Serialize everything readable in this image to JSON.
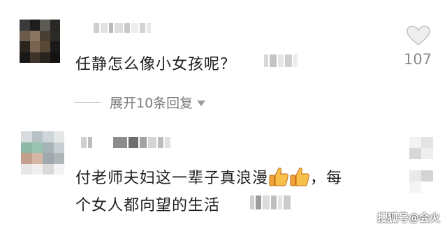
{
  "comments": [
    {
      "text": "任静怎么像小女孩呢？",
      "like_count": "107",
      "expand_label": "展开10条回复"
    },
    {
      "text_line1": "付老师夫妇这一辈子真浪漫",
      "text_line1_tail": "，每",
      "text_line2": "个女人都向望的生活",
      "reaction_icons": [
        "thumbs-up-emoji",
        "thumbs-up-emoji"
      ]
    }
  ],
  "icons": {
    "like": "heart-outline-icon",
    "expand": "triangle-down-icon"
  },
  "watermark": "搜狐号@会火",
  "colors": {
    "text": "#1f1f1f",
    "muted": "#8a8a8a",
    "expand": "#7b7b7b"
  }
}
